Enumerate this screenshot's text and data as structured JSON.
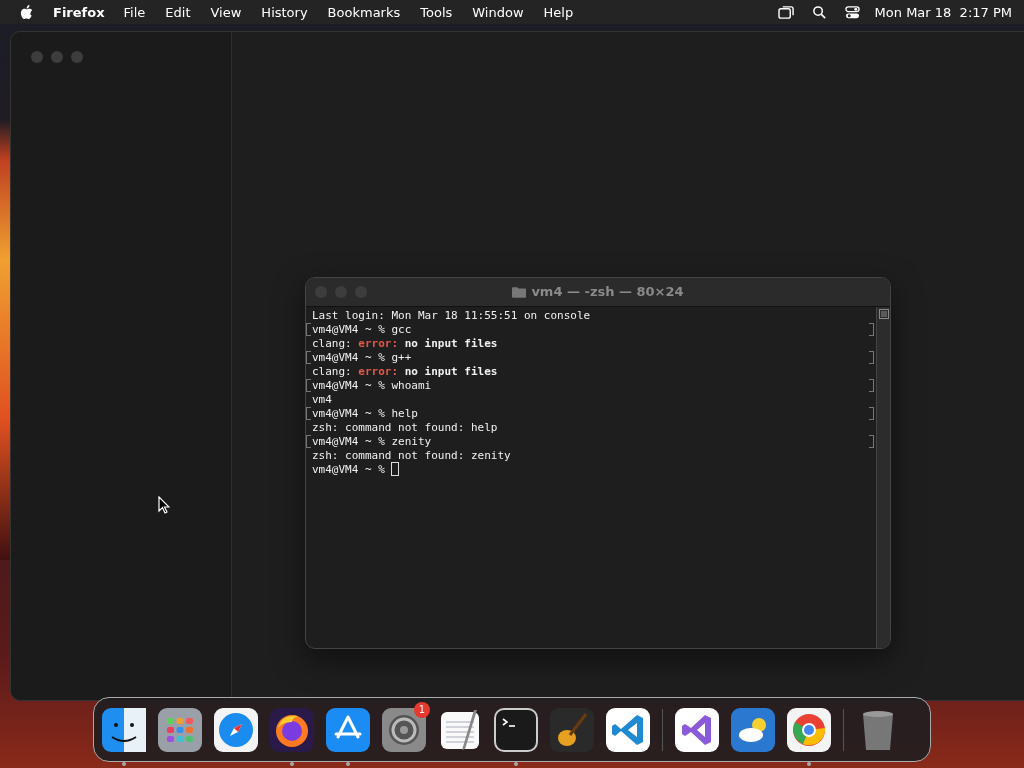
{
  "menu_bar": {
    "app_name": "Firefox",
    "menus": [
      "File",
      "Edit",
      "View",
      "History",
      "Bookmarks",
      "Tools",
      "Window",
      "Help"
    ],
    "clock": "Mon Mar 18  2:17 PM"
  },
  "terminal": {
    "title": "vm4 — -zsh — 80×24",
    "lines": [
      {
        "kind": "output",
        "text": "Last login: Mon Mar 18 11:55:51 on console",
        "marked": false
      },
      {
        "kind": "prompt",
        "text": "vm4@VM4 ~ % gcc",
        "marked": true
      },
      {
        "kind": "error",
        "prefix": "clang: ",
        "label": "error:",
        "message": " no input files",
        "marked": false
      },
      {
        "kind": "prompt",
        "text": "vm4@VM4 ~ % g++",
        "marked": true
      },
      {
        "kind": "error",
        "prefix": "clang: ",
        "label": "error:",
        "message": " no input files",
        "marked": false
      },
      {
        "kind": "prompt",
        "text": "vm4@VM4 ~ % whoami",
        "marked": true
      },
      {
        "kind": "output",
        "text": "vm4",
        "marked": false
      },
      {
        "kind": "prompt",
        "text": "vm4@VM4 ~ % help",
        "marked": true
      },
      {
        "kind": "output",
        "text": "zsh: command not found: help",
        "marked": false
      },
      {
        "kind": "prompt",
        "text": "vm4@VM4 ~ % zenity",
        "marked": true
      },
      {
        "kind": "output",
        "text": "zsh: command not found: zenity",
        "marked": false
      },
      {
        "kind": "input",
        "text": "vm4@VM4 ~ % ",
        "marked": false
      }
    ]
  },
  "dock": [
    {
      "kind": "finder",
      "running": true
    },
    {
      "kind": "launchpad",
      "running": false
    },
    {
      "kind": "safari",
      "running": false
    },
    {
      "kind": "firefox",
      "running": true
    },
    {
      "kind": "appstore",
      "running": true
    },
    {
      "kind": "settings",
      "running": false,
      "badge": "1"
    },
    {
      "kind": "textedit",
      "running": false
    },
    {
      "kind": "terminal",
      "running": true
    },
    {
      "kind": "garageband",
      "running": false
    },
    {
      "kind": "vscode",
      "running": false
    },
    {
      "kind": "divider"
    },
    {
      "kind": "visualstudio",
      "running": false
    },
    {
      "kind": "weather",
      "running": false
    },
    {
      "kind": "chrome",
      "running": true
    },
    {
      "kind": "divider"
    },
    {
      "kind": "trash",
      "running": false
    }
  ]
}
